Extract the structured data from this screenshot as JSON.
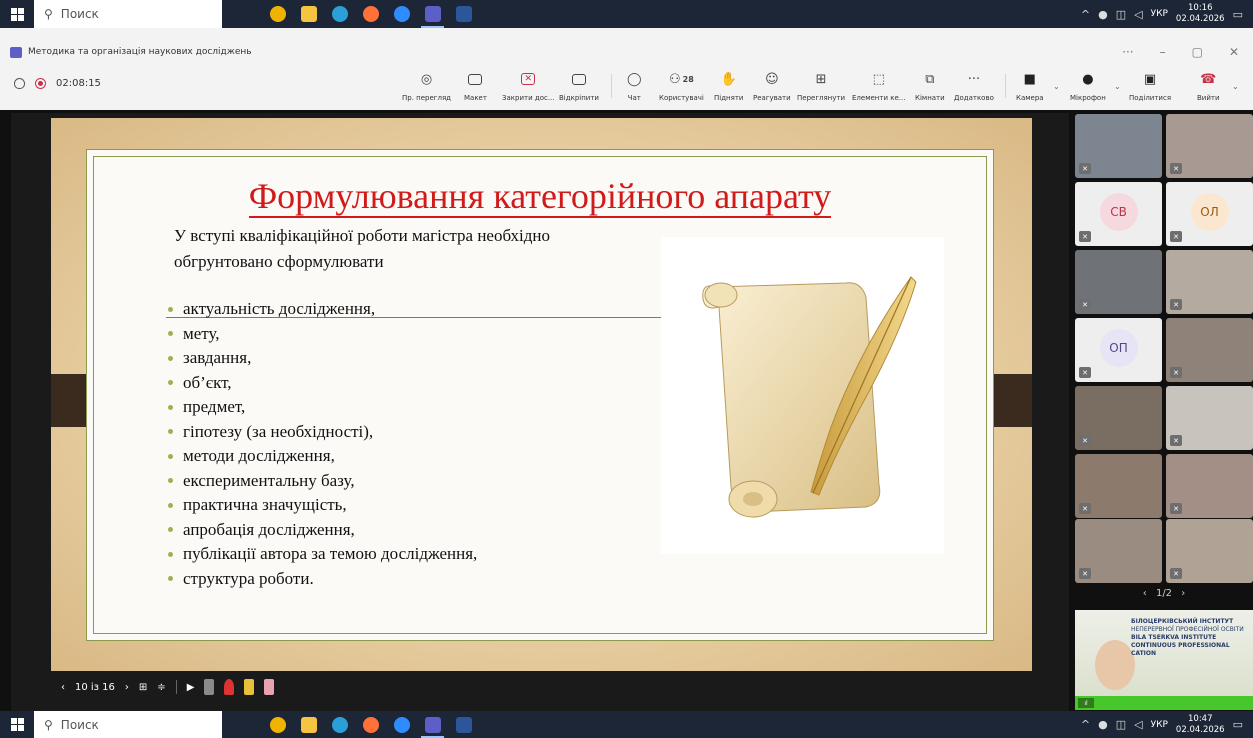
{
  "taskbar_top": {
    "search_placeholder": "Поиск",
    "time": "10:16",
    "date": "02.04.2026",
    "lang": "УКР"
  },
  "taskbar_bottom": {
    "search_placeholder": "Поиск",
    "time": "10:47",
    "date": "02.04.2026",
    "lang": "УКР"
  },
  "window": {
    "title": "Методика та організація наукових досліджень",
    "more": "···"
  },
  "meeting": {
    "timer": "02:08:15",
    "tools": {
      "view": "Пр. перегляд",
      "layout": "Макет",
      "stop_share": "Закрити дос...",
      "popout": "Відкріпити",
      "chat": "Чат",
      "people": "Користувачі",
      "people_count": "28",
      "raise": "Підняти",
      "react": "Реагувати",
      "view_mode": "Переглянути",
      "apps": "Елементи ке...",
      "rooms": "Кімнати",
      "more": "Додатково",
      "camera": "Камера",
      "mic": "Мікрофон",
      "share": "Поділитися",
      "leave": "Вийти"
    }
  },
  "slide": {
    "title": "Формулювання категорійного апарату",
    "intro": "У вступі кваліфікаційної роботи магістра необхідно обгрунтовано сформулювати",
    "bullets": [
      "актуальність дослідження,",
      "мету,",
      "завдання,",
      "об’єкт,",
      "предмет,",
      "гіпотезу (за необхідності),",
      "методи дослідження,",
      "експериментальну базу,",
      "практична значущість,",
      "апробація дослідження,",
      "публікації автора за темою дослідження,",
      "структура роботи."
    ]
  },
  "presenter": {
    "page_indicator": "10 із 16"
  },
  "gallery": {
    "avatars": [
      {
        "initials": "СВ",
        "bg": "#f6d9de",
        "fg": "#b3354c"
      },
      {
        "initials": "ОЛ",
        "bg": "#fbe7cf",
        "fg": "#9a5a12"
      },
      {
        "initials": "ОП",
        "bg": "#e6e4f5",
        "fg": "#4b4a8c"
      }
    ],
    "pager": "1/2"
  },
  "self_view": {
    "line1": "БІЛОЦЕРКІВСЬКИЙ ІНСТИТУТ",
    "line2": "НЕПЕРЕРВНОЇ ПРОФЕСІЙНОЇ ОСВІТИ",
    "line3": "BILA TSERKVA INSTITUTE",
    "line4": "CONTINUOUS PROFESSIONAL",
    "line5": "CATION"
  },
  "colors": {
    "accent": "#5b5fc7",
    "record": "#c4314b",
    "leave": "#c4314b",
    "title_red": "#d11a1a"
  }
}
